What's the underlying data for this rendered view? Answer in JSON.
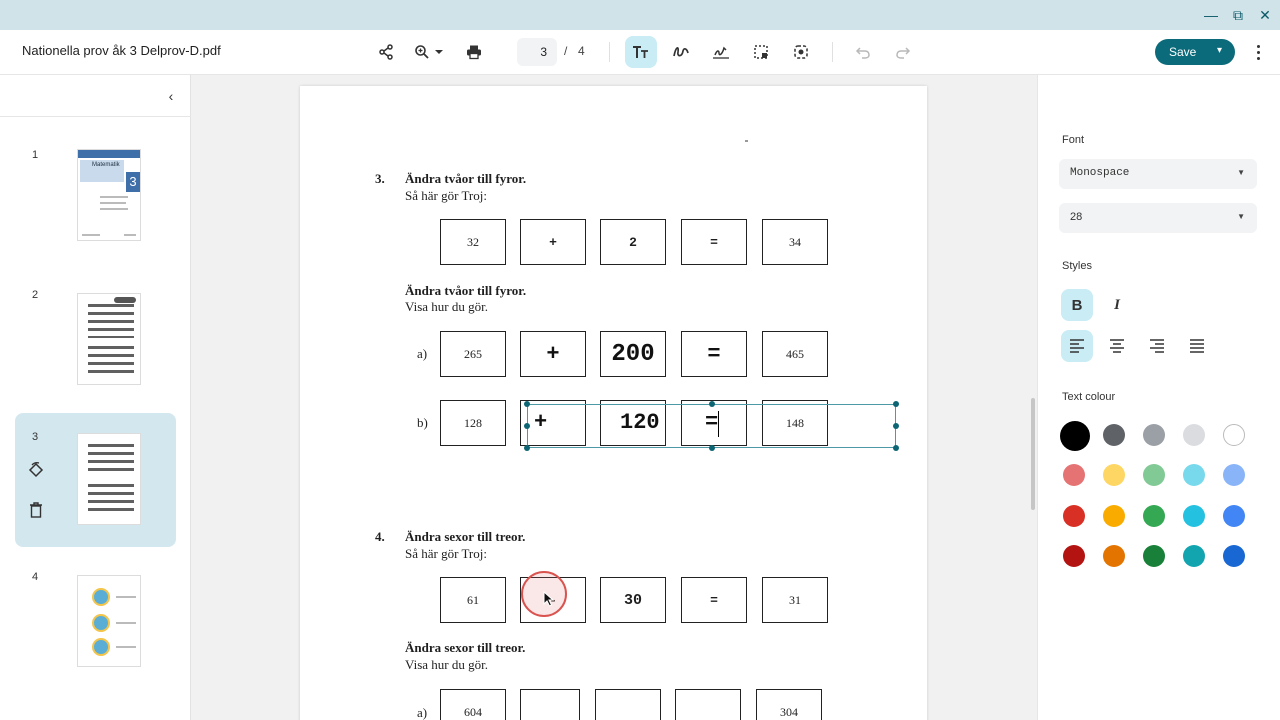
{
  "app": {
    "window_controls": {
      "minimize": "—",
      "restore": "⧉",
      "close": "✕"
    },
    "file_name": "Nationella prov åk 3 Delprov-D.pdf"
  },
  "toolbar": {
    "share_icon": "share-icon",
    "zoom_icon": "zoom-in-icon",
    "print_icon": "print-icon",
    "page_current": "3",
    "page_separator": "/",
    "page_total": "4",
    "tools": [
      "text-tool-icon",
      "draw-icon",
      "signature-icon",
      "select-area-icon",
      "lasso-icon"
    ],
    "undo_icon": "undo-icon",
    "redo_icon": "redo-icon",
    "save_label": "Save",
    "save_caret": "▾",
    "more_icon": "more-vert-icon"
  },
  "sidebar": {
    "collapse_icon": "‹",
    "thumbnails": [
      {
        "number": "1",
        "selected": false,
        "cover_title": "Matematik",
        "cover_number": "3"
      },
      {
        "number": "2",
        "selected": false
      },
      {
        "number": "3",
        "selected": true,
        "actions": [
          "rotate-icon",
          "delete-icon"
        ]
      },
      {
        "number": "4",
        "selected": false
      }
    ]
  },
  "document": {
    "q3": {
      "number": "3.",
      "title": "Ändra tvåor till fyror.",
      "sub": "Så här gör Troj:",
      "example": [
        "32",
        "+",
        "2",
        "=",
        "34"
      ],
      "title2": "Ändra tvåor till fyror.",
      "sub2": "Visa hur du gör.",
      "row_a": {
        "label": "a)",
        "start": "265",
        "op": "+",
        "value": "200",
        "eq": "=",
        "result": "465"
      },
      "row_b": {
        "label": "b)",
        "start": "128",
        "op": "+",
        "value": "120",
        "eq": "=",
        "result": "148"
      }
    },
    "q4": {
      "number": "4.",
      "title": "Ändra sexor till treor.",
      "sub": "Så här gör Troj:",
      "example": [
        "61",
        "-",
        "30",
        "=",
        "31"
      ],
      "title2": "Ändra sexor till treor.",
      "sub2": "Visa hur du gör.",
      "row_a": {
        "label": "a)",
        "start": "604",
        "result": "304"
      }
    }
  },
  "panel": {
    "font_label": "Font",
    "font_value": "Monospace",
    "size_value": "28",
    "styles_label": "Styles",
    "bold_label": "B",
    "italic_label": "I",
    "alignments": [
      "align-left-icon",
      "align-center-icon",
      "align-right-icon",
      "align-justify-icon"
    ],
    "text_colour_label": "Text colour",
    "colours": [
      [
        "#000000",
        "#5f6368",
        "#9aa0a6",
        "#dadce0",
        "#ffffff"
      ],
      [
        "#e57373",
        "#fdd663",
        "#81c995",
        "#78d9ec",
        "#8ab4f8"
      ],
      [
        "#d93025",
        "#f9ab00",
        "#34a853",
        "#24c1e0",
        "#4285f4"
      ],
      [
        "#b31412",
        "#e37400",
        "#188038",
        "#12a4af",
        "#1967d2"
      ]
    ]
  }
}
